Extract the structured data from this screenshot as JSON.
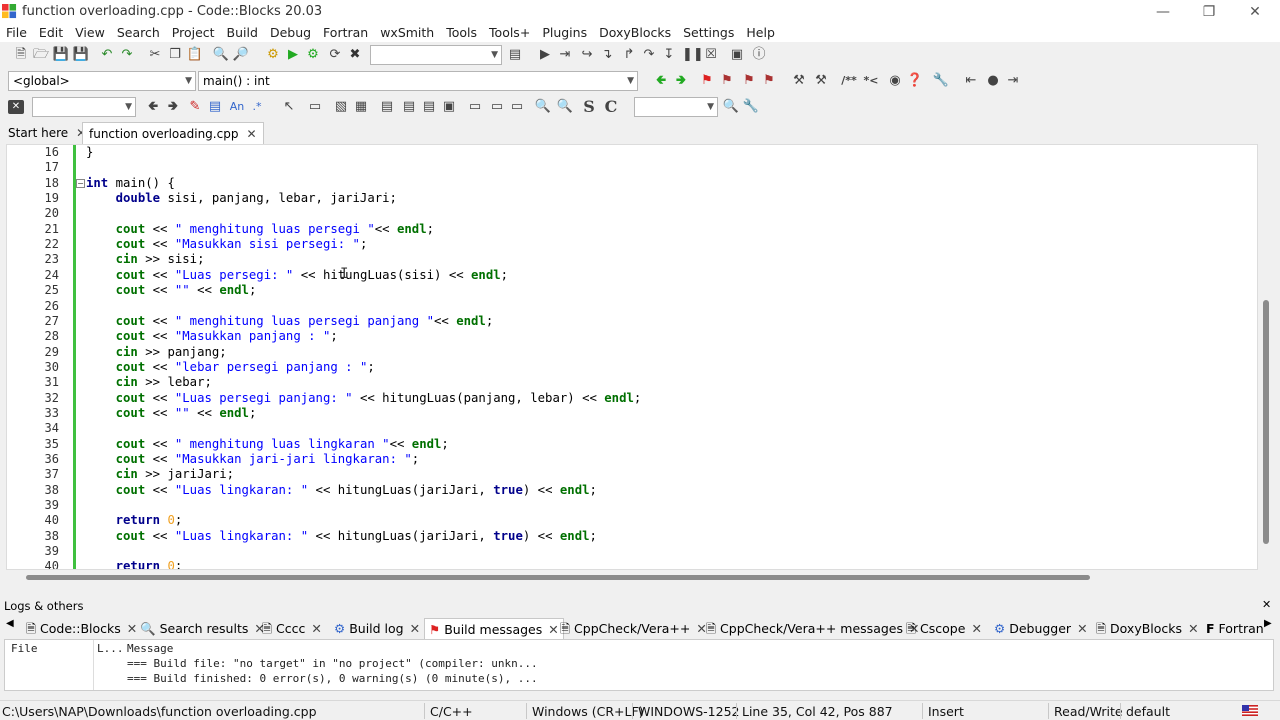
{
  "window": {
    "title": "function overloading.cpp - Code::Blocks 20.03"
  },
  "menu": [
    "File",
    "Edit",
    "View",
    "Search",
    "Project",
    "Build",
    "Debug",
    "Fortran",
    "wxSmith",
    "Tools",
    "Tools+",
    "Plugins",
    "DoxyBlocks",
    "Settings",
    "Help"
  ],
  "toolbar2": {
    "scope": "<global>",
    "function": "main() : int"
  },
  "tabs": [
    {
      "label": "Start here"
    },
    {
      "label": "function overloading.cpp"
    }
  ],
  "editor": {
    "lines": [
      {
        "n": "16",
        "t": "}"
      },
      {
        "n": "17",
        "t": ""
      },
      {
        "n": "18",
        "t": "int main() {"
      },
      {
        "n": "19",
        "t": "    double sisi, panjang, lebar, jariJari;"
      },
      {
        "n": "20",
        "t": ""
      },
      {
        "n": "21",
        "t": "    cout << \" menghitung luas persegi \"<< endl;"
      },
      {
        "n": "22",
        "t": "    cout << \"Masukkan sisi persegi: \";"
      },
      {
        "n": "23",
        "t": "    cin >> sisi;"
      },
      {
        "n": "24",
        "t": "    cout << \"Luas persegi: \" << hitungLuas(sisi) << endl;"
      },
      {
        "n": "25",
        "t": "    cout << \"\" << endl;"
      },
      {
        "n": "26",
        "t": ""
      },
      {
        "n": "27",
        "t": "    cout << \" menghitung luas persegi panjang \"<< endl;"
      },
      {
        "n": "28",
        "t": "    cout << \"Masukkan panjang : \";"
      },
      {
        "n": "29",
        "t": "    cin >> panjang;"
      },
      {
        "n": "30",
        "t": "    cout << \"lebar persegi panjang : \";"
      },
      {
        "n": "31",
        "t": "    cin >> lebar;"
      },
      {
        "n": "32",
        "t": "    cout << \"Luas persegi panjang: \" << hitungLuas(panjang, lebar) << endl;"
      },
      {
        "n": "33",
        "t": "    cout << \"\" << endl;"
      },
      {
        "n": "34",
        "t": ""
      },
      {
        "n": "35",
        "t": "    cout << \" menghitung luas lingkaran \"<< endl;"
      },
      {
        "n": "36",
        "t": "    cout << \"Masukkan jari-jari lingkaran: \";"
      },
      {
        "n": "37",
        "t": "    cin >> jariJari;"
      },
      {
        "n": "38",
        "t": "    cout << \"Luas lingkaran: \" << hitungLuas(jariJari, true) << endl;"
      },
      {
        "n": "39",
        "t": ""
      },
      {
        "n": "40",
        "t": "    return 0;"
      },
      {
        "n": "38",
        "t": "    cout << \"Luas lingkaran: \" << hitungLuas(jariJari, true) << endl;"
      },
      {
        "n": "39",
        "t": ""
      },
      {
        "n": "40",
        "t": "    return 0;"
      }
    ]
  },
  "logs": {
    "title": "Logs & others",
    "tabs": [
      "Code::Blocks",
      "Search results",
      "Cccc",
      "Build log",
      "Build messages",
      "CppCheck/Vera++",
      "CppCheck/Vera++ messages",
      "Cscope",
      "Debugger",
      "DoxyBlocks",
      "Fortran"
    ],
    "columns": [
      "File",
      "L...",
      "Message"
    ],
    "rows": [
      "=== Build file: \"no target\" in \"no project\" (compiler: unkn...",
      "=== Build finished: 0 error(s), 0 warning(s) (0 minute(s), ..."
    ]
  },
  "status": {
    "path": "C:\\Users\\NAP\\Downloads\\function overloading.cpp",
    "lang": "C/C++",
    "eol": "Windows (CR+LF)",
    "enc": "WINDOWS-1252",
    "pos": "Line 35, Col 42, Pos 887",
    "mode": "Insert",
    "rw": "Read/Write",
    "profile": "default"
  }
}
